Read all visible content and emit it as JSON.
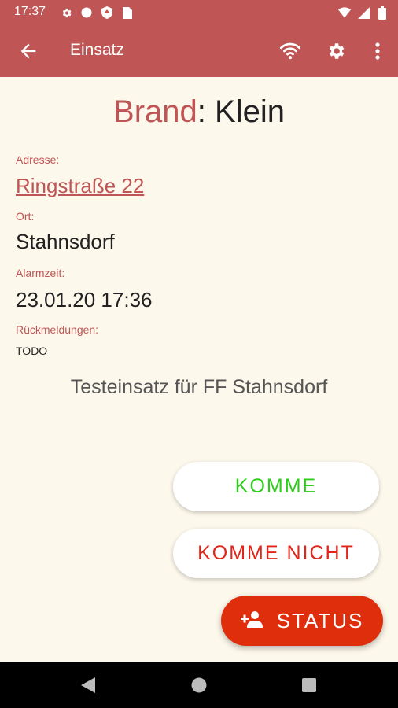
{
  "status_bar": {
    "time": "17:37",
    "left_icons": [
      "gear-icon",
      "circle-icon",
      "shield-icon",
      "sim-icon"
    ],
    "right_icons": [
      "wifi-icon",
      "signal-icon",
      "battery-icon"
    ]
  },
  "app_bar": {
    "title": "Einsatz",
    "back_icon": "arrow-left-icon",
    "actions": [
      "wifi-icon",
      "gear-icon",
      "more-vert-icon"
    ]
  },
  "incident": {
    "kind": "Brand",
    "separator": ": ",
    "level": "Klein",
    "fields": [
      {
        "label": "Adresse:",
        "value": "Ringstraße 22"
      },
      {
        "label": "Ort:",
        "value": "Stahnsdorf"
      },
      {
        "label": "Alarmzeit:",
        "value": "23.01.20 17:36"
      },
      {
        "label": "Rückmeldungen:",
        "value": "TODO"
      }
    ],
    "description": "Testeinsatz für FF Stahnsdorf"
  },
  "actions": {
    "komme": "KOMME",
    "komme_nicht": "KOMME NICHT",
    "status": "STATUS"
  },
  "colors": {
    "primary": "#c05555",
    "background": "#fdf8ec",
    "komme": "#2ecc1a",
    "komme_nicht": "#e0261a",
    "fab": "#de2e0c"
  },
  "nav_bar": [
    "back-triangle-icon",
    "home-circle-icon",
    "recents-square-icon"
  ]
}
